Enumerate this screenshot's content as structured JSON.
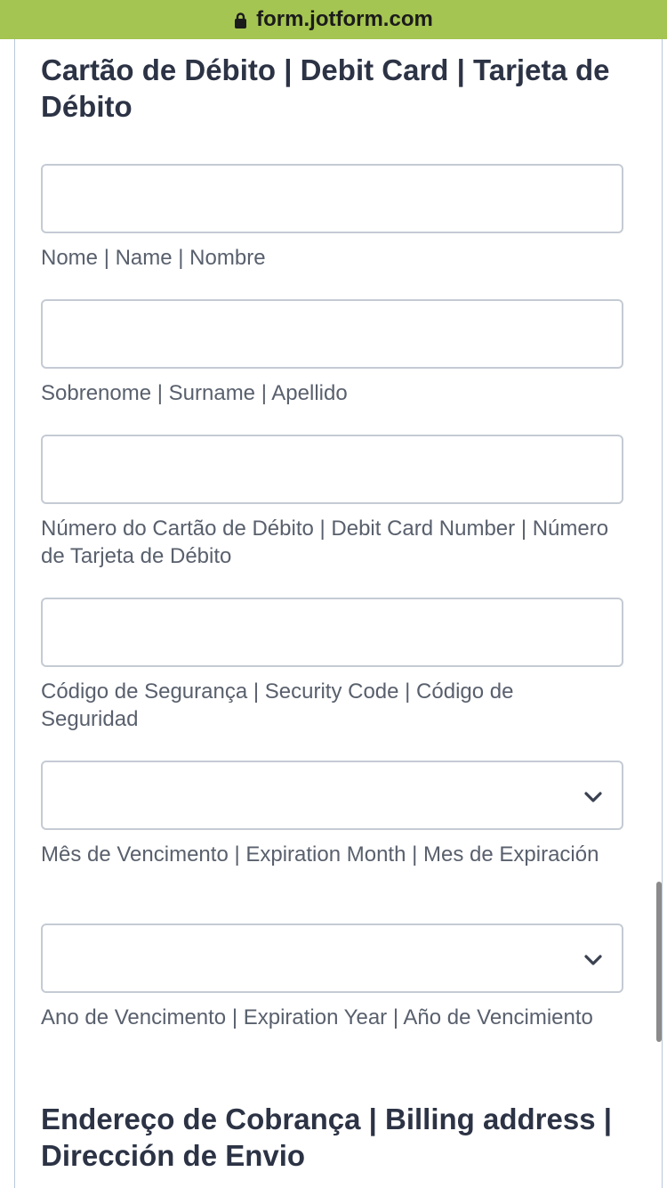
{
  "browser": {
    "url": "form.jotform.com"
  },
  "form": {
    "section_title": "Cartão de Débito | Debit Card | Tarjeta de Débito",
    "fields": {
      "name": {
        "value": "",
        "label": "Nome | Name | Nombre"
      },
      "surname": {
        "value": "",
        "label": "Sobrenome | Surname | Apellido"
      },
      "card_number": {
        "value": "",
        "label": "Número do Cartão de Débito | Debit Card Number | Número de Tarjeta de Débito"
      },
      "security_code": {
        "value": "",
        "label": "Código de Segurança | Security Code | Código de Seguridad"
      },
      "exp_month": {
        "value": "",
        "label": "Mês de Vencimento | Expiration Month | Mes de Expiración"
      },
      "exp_year": {
        "value": "",
        "label": "Ano de Vencimento | Expiration Year | Año de Vencimiento"
      }
    },
    "billing_title": "Endereço de Cobrança | Billing address | Dirección de Envio"
  },
  "icons": {
    "lock": "lock-icon",
    "select_arrow": "chevron-down-icon"
  },
  "colors": {
    "browser_bar": "#a5c552",
    "heading": "#2c3345",
    "sublabel": "#59606d",
    "field_border": "#c5cbd4"
  }
}
